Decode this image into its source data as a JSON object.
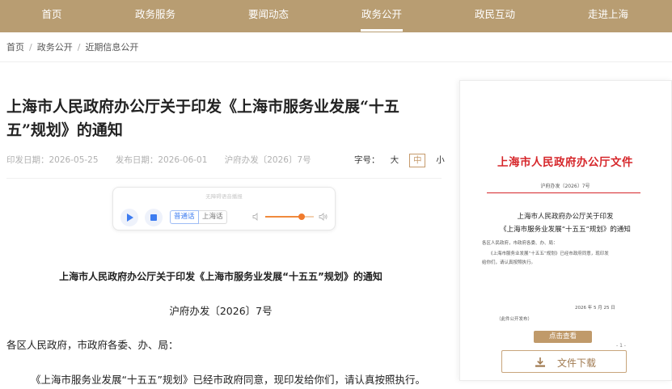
{
  "nav": {
    "items": [
      {
        "label": "首页",
        "active": false
      },
      {
        "label": "政务服务",
        "active": false
      },
      {
        "label": "要闻动态",
        "active": false
      },
      {
        "label": "政务公开",
        "active": true
      },
      {
        "label": "政民互动",
        "active": false
      },
      {
        "label": "走进上海",
        "active": false
      }
    ],
    "bg_color": "#b89d72"
  },
  "breadcrumb": [
    "首页",
    "政务公开",
    "近期信息公开"
  ],
  "breadcrumb_sep": "/",
  "article": {
    "title_line1": "上海市人民政府办公厅关于印发《上海市服务业发展“十五",
    "title_line2": "五”规划》的通知",
    "issue_date": "印发日期：2026-05-25",
    "publish_date": "发布日期：2026-06-01",
    "doc_number": "沪府办发〔2026〕7号",
    "font_size_label": "字号：",
    "font_sizes": [
      "大",
      "中",
      "小"
    ],
    "font_size_selected": "中"
  },
  "player": {
    "caption": "无障碍语音播报",
    "lang_mandarin": "普通话",
    "lang_shanghai": "上海话",
    "volume": 0.75,
    "accent": "#3d7cf0"
  },
  "body": {
    "doc_title": "上海市人民政府办公厅关于印发《上海市服务业发展“十五五”规划》的通知",
    "doc_no": "沪府办发〔2026〕7号",
    "salutation": "各区人民政府，市政府各委、办、局：",
    "paragraph": "《上海市服务业发展“十五五”规划》已经市政府同意，现印发给你们，请认真按照执行。"
  },
  "preview": {
    "header": "上海市人民政府办公厅文件",
    "number": "沪府办发〔2026〕7号",
    "title_line1": "上海市人民政府办公厅关于印发",
    "title_line2": "《上海市服务业发展“十五五”规划》的通知",
    "salutation": "各区人民政府，市政府各委、办、局：",
    "para_line1": "《上海市服务业发展“十五五”规划》已经市政府同意，现印发",
    "para_line2": "给你们，请认真按照执行。",
    "date": "2026 年 5 月 25 日",
    "note": "（此件公开发布）",
    "header_color": "#d6262a"
  },
  "actions": {
    "view_label": "点击查看",
    "page_indicator": "- 1 -",
    "download_label": "文件下载"
  }
}
